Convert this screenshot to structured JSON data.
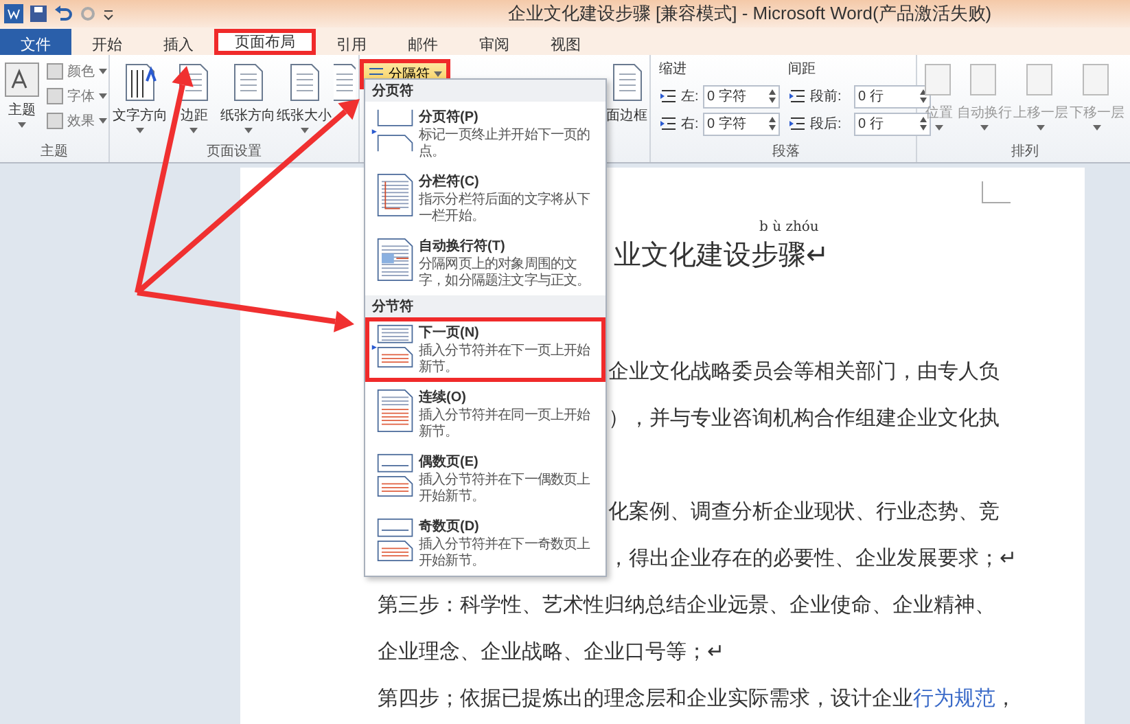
{
  "title_bar": {
    "title": "企业文化建设步骤 [兼容模式] - Microsoft Word(产品激活失败)"
  },
  "tabs": [
    {
      "label": "文件",
      "kind": "file",
      "selected": false,
      "annotated": false
    },
    {
      "label": "开始",
      "kind": "normal",
      "selected": false,
      "annotated": false
    },
    {
      "label": "插入",
      "kind": "normal",
      "selected": false,
      "annotated": false
    },
    {
      "label": "页面布局",
      "kind": "normal",
      "selected": true,
      "annotated": true
    },
    {
      "label": "引用",
      "kind": "normal",
      "selected": false,
      "annotated": false
    },
    {
      "label": "邮件",
      "kind": "normal",
      "selected": false,
      "annotated": false
    },
    {
      "label": "审阅",
      "kind": "normal",
      "selected": false,
      "annotated": false
    },
    {
      "label": "视图",
      "kind": "normal",
      "selected": false,
      "annotated": false
    }
  ],
  "theme_group": {
    "label": "主题",
    "button": "主题",
    "items": [
      "颜色",
      "字体",
      "效果"
    ]
  },
  "page_setup_group": {
    "label": "页面设置",
    "buttons": [
      "文字方向",
      "边距",
      "纸张方向",
      "纸张大小"
    ],
    "breaks_button": {
      "label": "分隔符",
      "annotated": true
    }
  },
  "page_background_group": {
    "buttons": [
      "面边框"
    ]
  },
  "paragraph_group": {
    "label": "段落",
    "indent": {
      "heading": "缩进",
      "fields": [
        {
          "label": "左:",
          "value": "0 字符"
        },
        {
          "label": "右:",
          "value": "0 字符"
        }
      ]
    },
    "spacing": {
      "heading": "间距",
      "fields": [
        {
          "label": "段前:",
          "value": "0 行"
        },
        {
          "label": "段后:",
          "value": "0 行"
        }
      ]
    }
  },
  "arrange_group": {
    "label": "排列",
    "buttons": [
      {
        "label": "位置",
        "disabled": true
      },
      {
        "label": "自动换行",
        "disabled": true
      },
      {
        "label": "上移一层",
        "disabled": true
      },
      {
        "label": "下移一层",
        "disabled": true
      }
    ]
  },
  "breaks_menu": {
    "sections": [
      {
        "heading": "分页符",
        "items": [
          {
            "kind": "page",
            "title": "分页符(P)",
            "description": "标记一页终止并开始下一页的点。",
            "annotated": false
          },
          {
            "kind": "column",
            "title": "分栏符(C)",
            "description": "指示分栏符后面的文字将从下一栏开始。",
            "annotated": false
          },
          {
            "kind": "wrap",
            "title": "自动换行符(T)",
            "description": "分隔网页上的对象周围的文字，如分隔题注文字与正文。",
            "annotated": false
          }
        ]
      },
      {
        "heading": "分节符",
        "items": [
          {
            "kind": "next",
            "title": "下一页(N)",
            "description": "插入分节符并在下一页上开始新节。",
            "annotated": true
          },
          {
            "kind": "continuous",
            "title": "连续(O)",
            "description": "插入分节符并在同一页上开始新节。",
            "annotated": false
          },
          {
            "kind": "even",
            "title": "偶数页(E)",
            "description": "插入分节符并在下一偶数页上开始新节。",
            "annotated": false
          },
          {
            "kind": "odd",
            "title": "奇数页(D)",
            "description": "插入分节符并在下一奇数页上开始新节。",
            "annotated": false
          }
        ]
      }
    ]
  },
  "document": {
    "pinyin": "b ù zhóu",
    "title": "业文化建设步骤↵",
    "lines": [
      {
        "kind": "covered",
        "segments": [
          {
            "text": "企业文化战略委员会等相关部门，由专人负",
            "link": false
          }
        ]
      },
      {
        "kind": "covered",
        "segments": [
          {
            "text": "），并与专业咨询机构合作组建企业文化执",
            "link": false
          }
        ]
      },
      {
        "kind": "covered",
        "segments": [
          {
            "text": "化案例、调查分析企业现状、行业态势、竞",
            "link": false
          }
        ]
      },
      {
        "kind": "covered",
        "segments": [
          {
            "text": "，得出企业存在的必要性、企业发展要求；↵",
            "link": false
          }
        ]
      },
      {
        "kind": "full",
        "segments": [
          {
            "text": "第三步：科学性、艺术性归纳总结企业远景、企业使命、企业精神、",
            "link": false
          }
        ]
      },
      {
        "kind": "full",
        "segments": [
          {
            "text": "企业理念、企业战略、企业口号等；↵",
            "link": false
          }
        ]
      },
      {
        "kind": "full",
        "segments": [
          {
            "text": "第四步；依据已提炼出的理念层和企业实际需求，设计企业",
            "link": false
          },
          {
            "text": "行为规范",
            "link": true
          },
          {
            "text": "，",
            "link": false
          }
        ]
      }
    ]
  }
}
